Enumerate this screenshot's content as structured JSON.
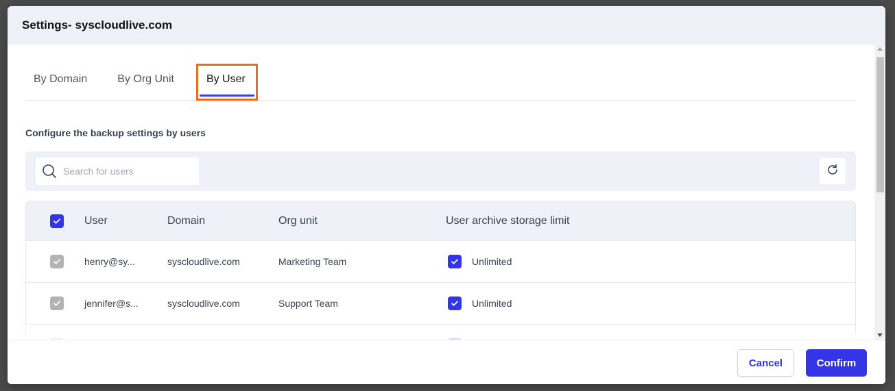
{
  "modal": {
    "title": "Settings- syscloudlive.com"
  },
  "tabs": [
    {
      "label": "By Domain",
      "active": false
    },
    {
      "label": "By Org Unit",
      "active": false
    },
    {
      "label": "By User",
      "active": true
    }
  ],
  "description": "Configure the backup settings by users",
  "search": {
    "placeholder": "Search for users",
    "value": ""
  },
  "icons": {
    "search": "search-icon",
    "refresh": "refresh-icon",
    "check": "check-icon"
  },
  "table": {
    "headers": {
      "user": "User",
      "domain": "Domain",
      "org_unit": "Org unit",
      "limit": "User archive storage limit"
    },
    "select_all_checked": true,
    "rows": [
      {
        "user": "henry@sy...",
        "domain": "syscloudlive.com",
        "org_unit": "Marketing Team",
        "limit": "Unlimited",
        "selected": true,
        "limit_checked": true
      },
      {
        "user": "jennifer@s...",
        "domain": "syscloudlive.com",
        "org_unit": "Support Team",
        "limit": "Unlimited",
        "selected": true,
        "limit_checked": true
      },
      {
        "user": "",
        "domain": "",
        "org_unit": "",
        "limit": "",
        "selected": true,
        "limit_checked": true
      }
    ]
  },
  "footer": {
    "cancel_label": "Cancel",
    "confirm_label": "Confirm"
  },
  "colors": {
    "accent": "#3535e8",
    "highlight": "#f26a1b",
    "header_bg": "#eef2f8"
  }
}
